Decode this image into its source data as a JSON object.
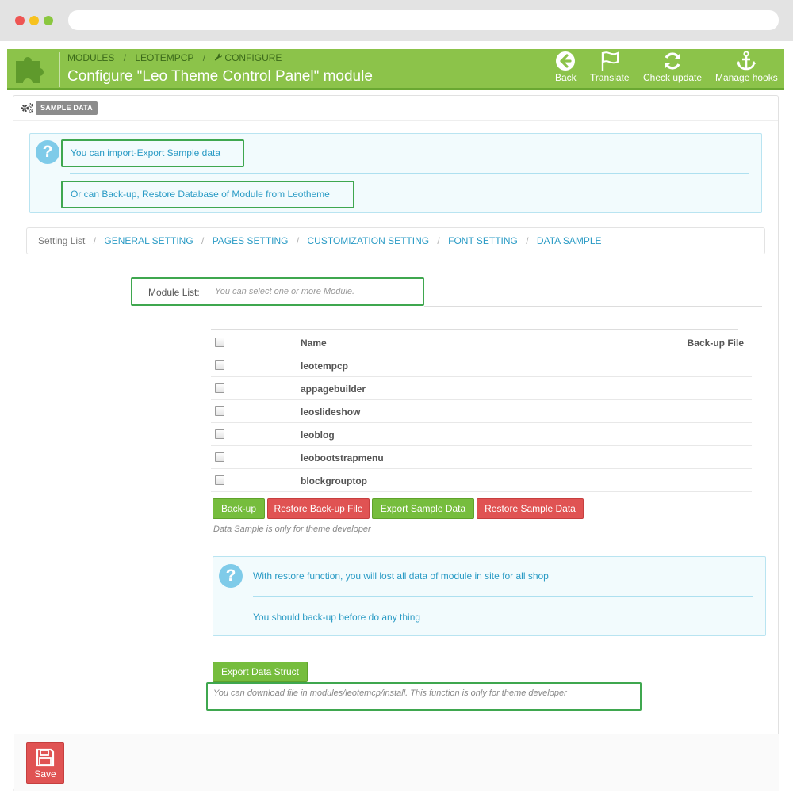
{
  "header": {
    "breadcrumb": [
      "MODULES",
      "LEOTEMPCP",
      "CONFIGURE"
    ],
    "title": "Configure \"Leo Theme Control Panel\" module",
    "toolbar": {
      "back": "Back",
      "translate": "Translate",
      "check_update": "Check update",
      "manage_hooks": "Manage hooks"
    },
    "colors": {
      "header_bg": "#8cc34a",
      "link": "#2a9bc5"
    }
  },
  "panel": {
    "badge": "SAMPLE DATA",
    "info_top": [
      "You can import-Export Sample data",
      "Or can Back-up, Restore Database of Module from Leotheme"
    ]
  },
  "setting_list": {
    "first": "Setting List",
    "links": [
      "GENERAL SETTING",
      "PAGES SETTING",
      "CUSTOMIZATION SETTING",
      "FONT SETTING",
      "DATA SAMPLE"
    ]
  },
  "module_list": {
    "label": "Module List:",
    "placeholder": "You can select one or more Module."
  },
  "table": {
    "headers": {
      "name": "Name",
      "backup": "Back-up File"
    },
    "rows": [
      "leotempcp",
      "appagebuilder",
      "leoslideshow",
      "leoblog",
      "leobootstrapmenu",
      "blockgrouptop"
    ]
  },
  "actions": {
    "backup": "Back-up",
    "restore_backup": "Restore Back-up File",
    "export_sample": "Export Sample Data",
    "restore_sample": "Restore Sample Data",
    "hint": "Data Sample is only for theme developer"
  },
  "info_bottom": [
    "With restore function, you will lost all data of module in site for all shop",
    "You should back-up before do any thing"
  ],
  "export_struct": {
    "label": "Export Data Struct",
    "hint": "You can download file in modules/leotemcp/install. This function is only for theme developer"
  },
  "footer": {
    "save": "Save"
  }
}
